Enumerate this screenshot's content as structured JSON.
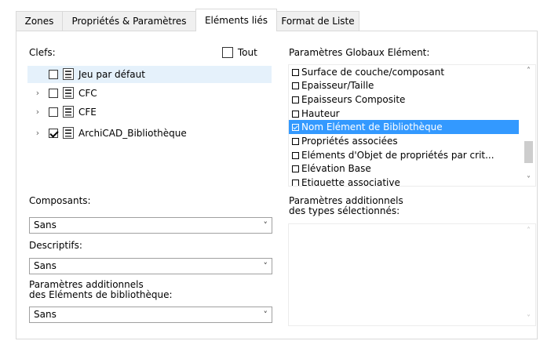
{
  "tabs": [
    {
      "label": "Zones"
    },
    {
      "label": "Propriétés & Paramètres"
    },
    {
      "label": "Eléments liés"
    },
    {
      "label": "Format de Liste"
    }
  ],
  "keys": {
    "label": "Clefs:",
    "all_label": "Tout",
    "all_checked": false,
    "items": [
      {
        "label": "Jeu par défaut",
        "checked": false,
        "expandable": false,
        "selected": true
      },
      {
        "label": "CFC",
        "checked": false,
        "expandable": true,
        "selected": false
      },
      {
        "label": "CFE",
        "checked": false,
        "expandable": true,
        "selected": false
      },
      {
        "label": "ArchiCAD_Bibliothèque",
        "checked": true,
        "expandable": true,
        "selected": false
      }
    ]
  },
  "global_params": {
    "label": "Paramètres Globaux Elément:",
    "items": [
      {
        "label": "Surface de couche/composant",
        "checked": false
      },
      {
        "label": "Epaisseur/Taille",
        "checked": false
      },
      {
        "label": "Epaisseurs Composite",
        "checked": false
      },
      {
        "label": "Hauteur",
        "checked": false
      },
      {
        "label": "Nom Elément de Bibliothèque",
        "checked": true,
        "selected": true
      },
      {
        "label": "Propriétés associées",
        "checked": false
      },
      {
        "label": "Eléments d'Objet de propriétés par crit...",
        "checked": false
      },
      {
        "label": "Elévation Base",
        "checked": false
      },
      {
        "label": "Etiquette associative",
        "checked": false
      }
    ]
  },
  "components": {
    "label": "Composants:",
    "value": "Sans"
  },
  "descriptors": {
    "label": "Descriptifs:",
    "value": "Sans"
  },
  "lib_params": {
    "label_line1": "Paramètres additionnels",
    "label_line2": "des Eléments de bibliothèque:",
    "value": "Sans"
  },
  "type_params": {
    "label_line1": "Paramètres additionnels",
    "label_line2": "des types sélectionnés:"
  },
  "icons": {
    "chevron": "chevron-right-icon",
    "dropdown": "chevron-down-icon",
    "set": "document-set-icon"
  },
  "colors": {
    "selection": "#3399ff",
    "tree_selection": "#e5f1fb"
  }
}
